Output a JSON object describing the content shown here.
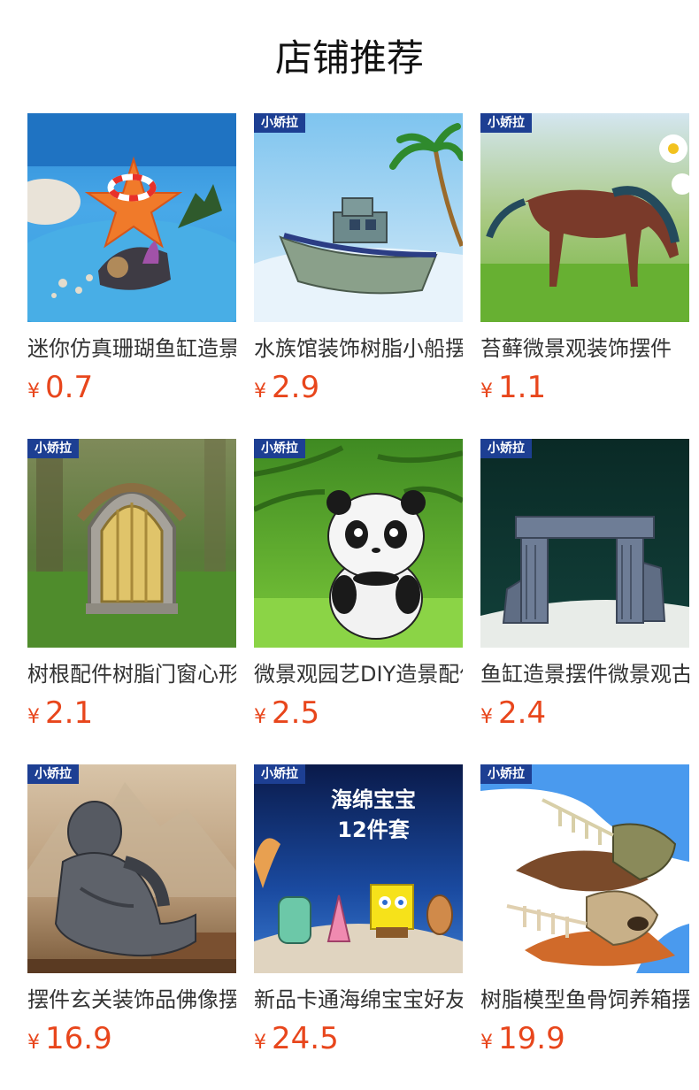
{
  "page_title": "店铺推荐",
  "badge_text": "小娇拉",
  "currency": "¥",
  "colors": {
    "price": "#e8461c",
    "badge_bg": "#1d3f93"
  },
  "products": [
    {
      "name": "迷你仿真珊瑚鱼缸造景摆件",
      "price": "0.7",
      "badge": false,
      "image": "starfish-ornament"
    },
    {
      "name": "水族馆装饰树脂小船摆件",
      "price": "2.9",
      "badge": true,
      "image": "boat-ornament"
    },
    {
      "name": "苔藓微景观装饰摆件",
      "price": "1.1",
      "badge": true,
      "image": "horse-figurine"
    },
    {
      "name": "树根配件树脂门窗心形装饰",
      "price": "2.1",
      "badge": true,
      "image": "fairy-door"
    },
    {
      "name": "微景观园艺DIY造景配件",
      "price": "2.5",
      "badge": true,
      "image": "panda-figurine"
    },
    {
      "name": "鱼缸造景摆件微景观古城",
      "price": "2.4",
      "badge": true,
      "image": "ruins-ornament"
    },
    {
      "name": "摆件玄关装饰品佛像摆件",
      "price": "16.9",
      "badge": true,
      "image": "buddha-statue"
    },
    {
      "name": "新品卡通海绵宝宝好友摆件",
      "price": "24.5",
      "badge": true,
      "image": "spongebob-set",
      "image_text": [
        "海绵宝宝",
        "12件套"
      ]
    },
    {
      "name": "树脂模型鱼骨饲养箱摆件",
      "price": "19.9",
      "badge": true,
      "image": "fish-skeleton"
    }
  ]
}
